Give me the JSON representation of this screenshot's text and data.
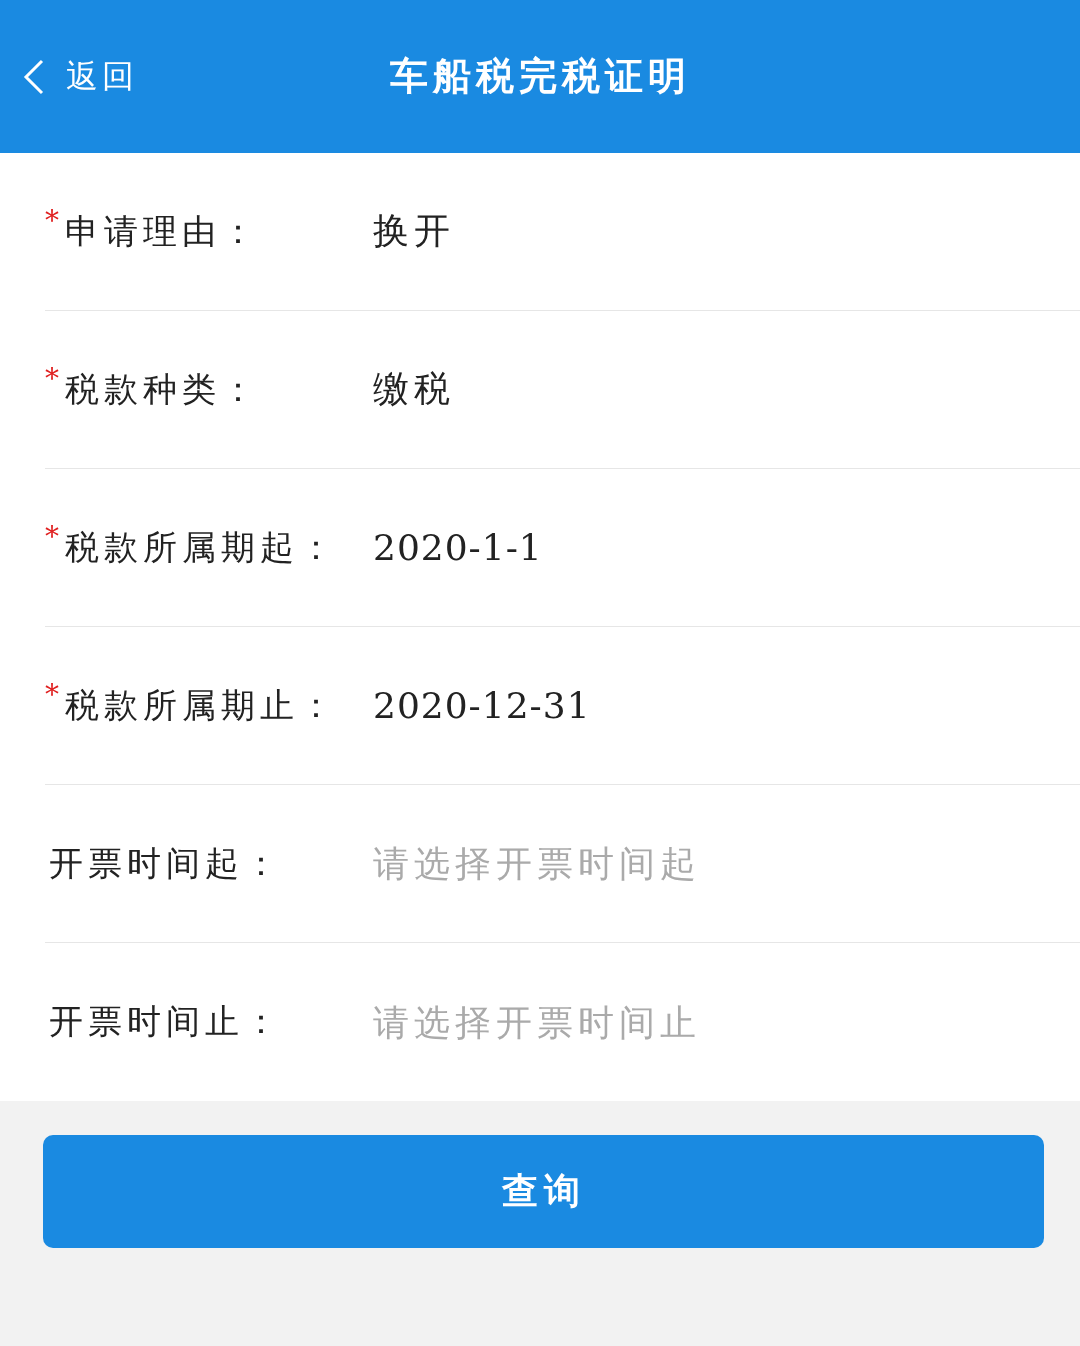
{
  "header": {
    "back_label": "返回",
    "title": "车船税完税证明"
  },
  "fields": [
    {
      "marker": "*",
      "label": "申请理由：",
      "value": "换开"
    },
    {
      "marker": "*",
      "label": "税款种类：",
      "value": "缴税"
    },
    {
      "marker": "*",
      "label": "税款所属期起：",
      "value": "2020-1-1"
    },
    {
      "marker": "*",
      "label": "税款所属期止：",
      "value": "2020-12-31"
    },
    {
      "label": "开票时间起：",
      "placeholder": "请选择开票时间起"
    },
    {
      "label": "开票时间止：",
      "placeholder": "请选择开票时间止"
    }
  ],
  "submit_button": "查询"
}
